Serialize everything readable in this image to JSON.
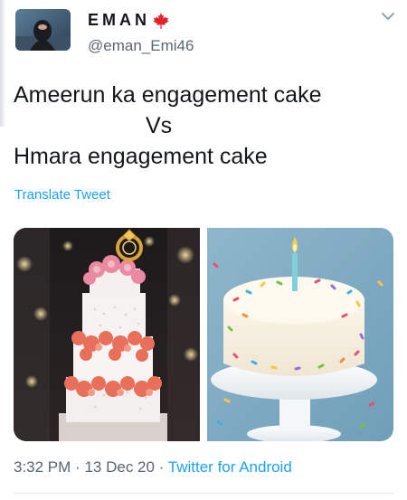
{
  "user": {
    "display_name": "EMAN",
    "handle": "@eman_Emi46",
    "name_badge_icon": "maple-leaf-icon",
    "badge_color": "#e0242c"
  },
  "tweet": {
    "lines": [
      "Ameerun ka engagement cake",
      "Vs",
      "Hmara engagement cake"
    ],
    "translate_label": "Translate Tweet"
  },
  "media": [
    {
      "description_icon": "tiered-cake-photo"
    },
    {
      "description_icon": "birthday-cake-photo"
    }
  ],
  "meta": {
    "time": "3:32 PM",
    "separator": "·",
    "date": "13 Dec 20",
    "source": "Twitter for Android"
  },
  "colors": {
    "link": "#1da1f2",
    "secondary_text": "#5b6670",
    "primary_text": "#14171a"
  }
}
